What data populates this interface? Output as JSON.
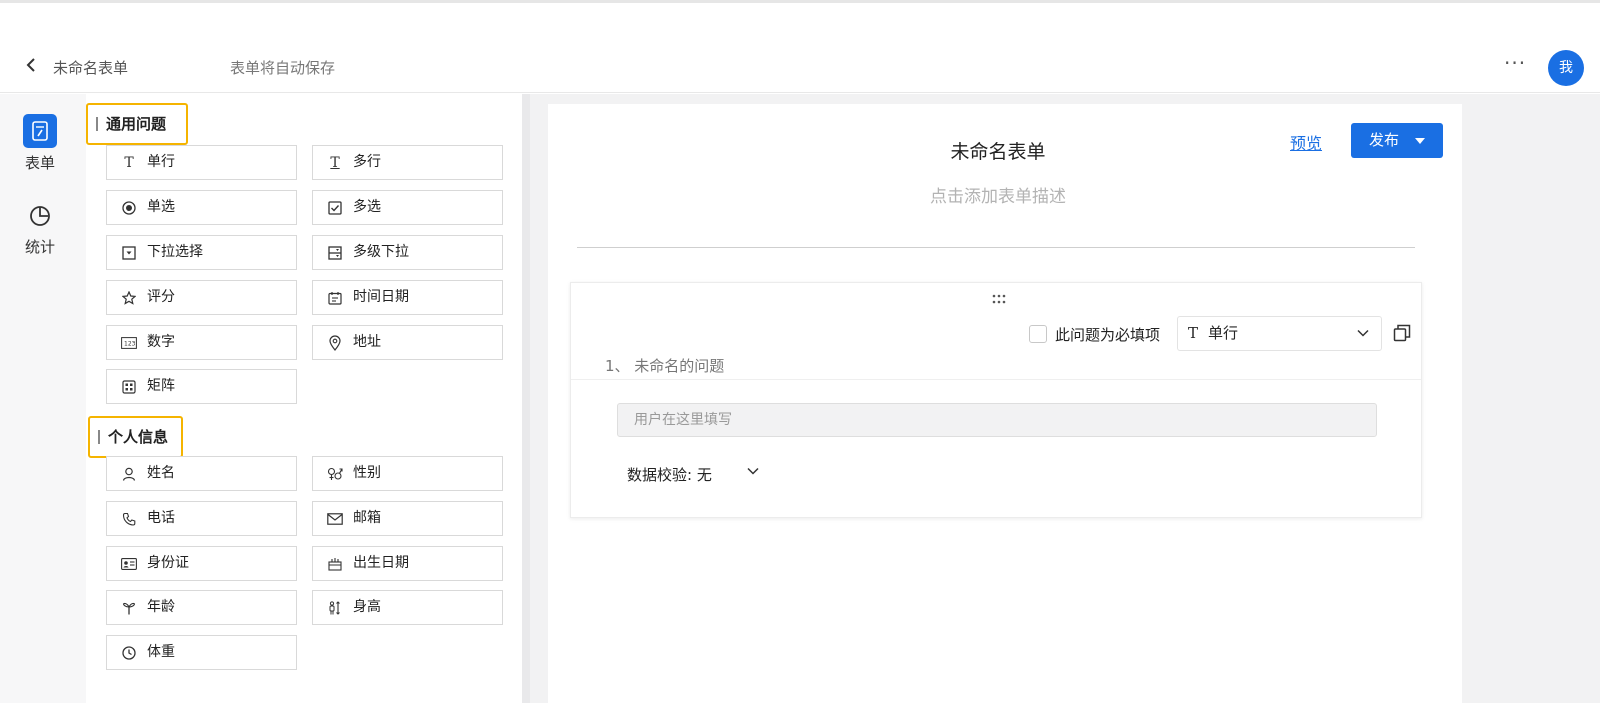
{
  "header": {
    "back_label": "<",
    "title": "未命名表单",
    "autosave": "表单将自动保存",
    "more": "···",
    "avatar": "我"
  },
  "rail": {
    "items": [
      {
        "label": "表单",
        "icon": "form-icon",
        "active": true
      },
      {
        "label": "统计",
        "icon": "pie-chart-icon",
        "active": false
      }
    ]
  },
  "palette": {
    "general_title": "通用问题",
    "general": [
      {
        "label": "单行",
        "icon": "single-line-icon"
      },
      {
        "label": "多行",
        "icon": "multi-line-icon"
      },
      {
        "label": "单选",
        "icon": "radio-icon"
      },
      {
        "label": "多选",
        "icon": "checkbox-icon"
      },
      {
        "label": "下拉选择",
        "icon": "dropdown-icon"
      },
      {
        "label": "多级下拉",
        "icon": "cascade-dropdown-icon"
      },
      {
        "label": "评分",
        "icon": "star-icon"
      },
      {
        "label": "时间日期",
        "icon": "calendar-icon"
      },
      {
        "label": "数字",
        "icon": "number-icon"
      },
      {
        "label": "地址",
        "icon": "location-icon"
      },
      {
        "label": "矩阵",
        "icon": "matrix-icon"
      }
    ],
    "personal_title": "个人信息",
    "personal": [
      {
        "label": "姓名",
        "icon": "person-icon"
      },
      {
        "label": "性别",
        "icon": "gender-icon"
      },
      {
        "label": "电话",
        "icon": "phone-icon"
      },
      {
        "label": "邮箱",
        "icon": "mail-icon"
      },
      {
        "label": "身份证",
        "icon": "id-card-icon"
      },
      {
        "label": "出生日期",
        "icon": "birthday-icon"
      },
      {
        "label": "年龄",
        "icon": "sprout-icon"
      },
      {
        "label": "身高",
        "icon": "height-icon"
      },
      {
        "label": "体重",
        "icon": "clock-icon"
      }
    ]
  },
  "form": {
    "title": "未命名表单",
    "description_placeholder": "点击添加表单描述",
    "preview": "预览",
    "publish": "发布",
    "question": {
      "required_label": "此问题为必填项",
      "required_checked": false,
      "type_icon": "T",
      "type_label": "单行",
      "title": "1、 未命名的问题",
      "answer_placeholder": "用户在这里填写",
      "validation": "数据校验: 无"
    }
  },
  "colors": {
    "accent": "#1a6fe3",
    "section_highlight": "#f5b400"
  }
}
